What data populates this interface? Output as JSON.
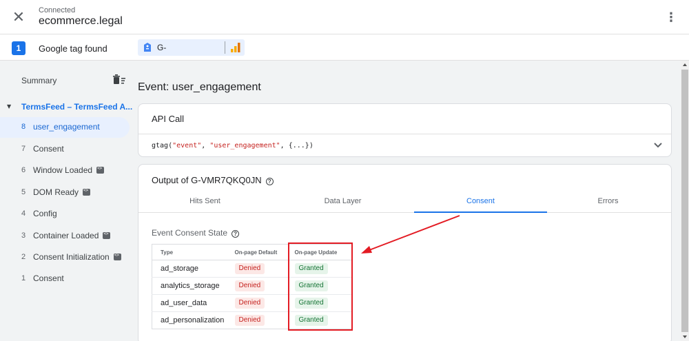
{
  "header": {
    "status": "Connected",
    "site": "ecommerce.legal",
    "close_glyph": "✕",
    "menu_glyph": "⋮"
  },
  "tagbar": {
    "count": "1",
    "found_label": "Google tag found",
    "tag_id": "G-"
  },
  "sidebar": {
    "summary_label": "Summary",
    "container_title": "TermsFeed – TermsFeed A...",
    "caret_glyph": "▼",
    "events": [
      {
        "num": "8",
        "label": "user_engagement",
        "selected": true,
        "code_badge": false
      },
      {
        "num": "7",
        "label": "Consent",
        "selected": false,
        "code_badge": false
      },
      {
        "num": "6",
        "label": "Window Loaded",
        "selected": false,
        "code_badge": true
      },
      {
        "num": "5",
        "label": "DOM Ready",
        "selected": false,
        "code_badge": true
      },
      {
        "num": "4",
        "label": "Config",
        "selected": false,
        "code_badge": false
      },
      {
        "num": "3",
        "label": "Container Loaded",
        "selected": false,
        "code_badge": true
      },
      {
        "num": "2",
        "label": "Consent Initialization",
        "selected": false,
        "code_badge": true
      },
      {
        "num": "1",
        "label": "Consent",
        "selected": false,
        "code_badge": false
      }
    ]
  },
  "main": {
    "event_title": "Event: user_engagement",
    "api_card": {
      "title": "API Call",
      "code_prefix": "gtag(",
      "code_arg1": "\"event\"",
      "code_sep": ", ",
      "code_arg2": "\"user_engagement\"",
      "code_suffix": ", {...})"
    },
    "output_card": {
      "title": "Output of G-VMR7QKQ0JN",
      "help_glyph": "?",
      "tabs": [
        {
          "label": "Hits Sent",
          "active": false
        },
        {
          "label": "Data Layer",
          "active": false
        },
        {
          "label": "Consent",
          "active": true
        },
        {
          "label": "Errors",
          "active": false
        }
      ],
      "consent_state_title": "Event Consent State",
      "table": {
        "headers": [
          "Type",
          "On-page Default",
          "On-page Update"
        ],
        "rows": [
          {
            "type": "ad_storage",
            "default": "Denied",
            "update": "Granted"
          },
          {
            "type": "analytics_storage",
            "default": "Denied",
            "update": "Granted"
          },
          {
            "type": "ad_user_data",
            "default": "Denied",
            "update": "Granted"
          },
          {
            "type": "ad_personalization",
            "default": "Denied",
            "update": "Granted"
          }
        ]
      }
    }
  },
  "colors": {
    "accent": "#1a73e8",
    "annotation": "#e31b23",
    "denied_bg": "#fce8e6",
    "granted_bg": "#e6f4ea"
  },
  "icons": {
    "close": "close-icon",
    "menu": "more-vert-icon",
    "tag": "google-tag-icon",
    "analytics": "analytics-bars-icon",
    "clear": "clear-list-icon",
    "expand": "chevron-down-icon",
    "help": "help-icon",
    "code": "code-badge-icon"
  }
}
